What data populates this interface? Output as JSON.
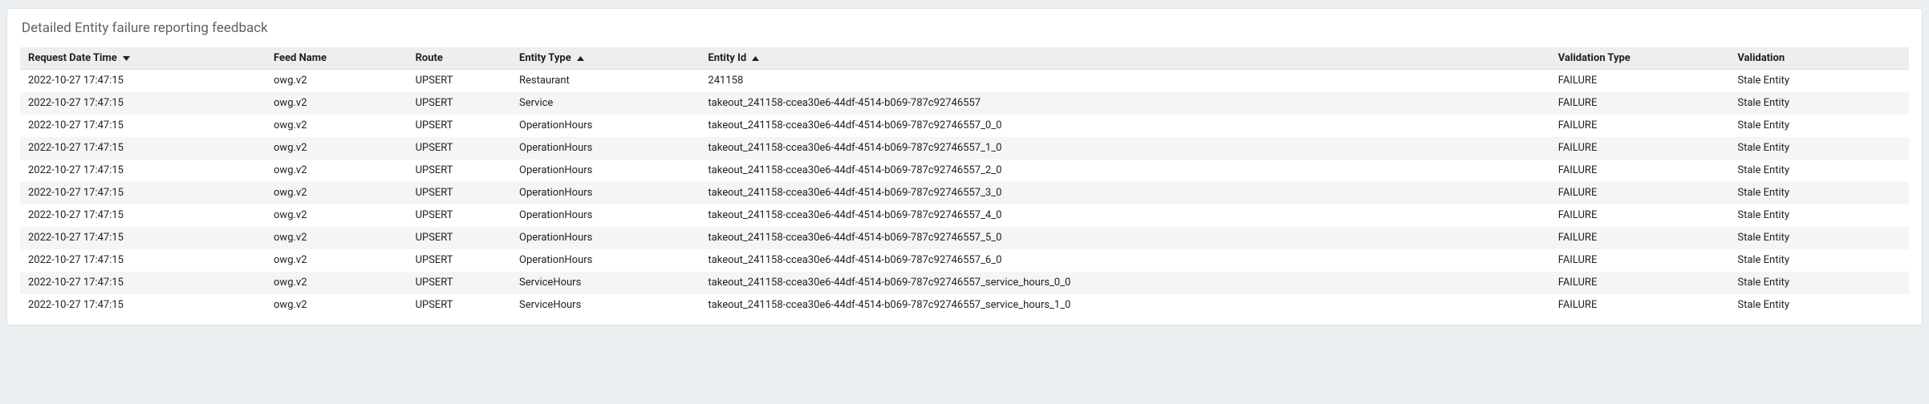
{
  "title": "Detailed Entity failure reporting feedback",
  "columns": {
    "request_datetime": "Request Date Time",
    "feed_name": "Feed Name",
    "route": "Route",
    "entity_type": "Entity Type",
    "entity_id": "Entity Id",
    "validation_type": "Validation Type",
    "validation": "Validation"
  },
  "sort": {
    "request_datetime": "desc",
    "entity_type": "asc",
    "entity_id": "asc"
  },
  "failure_color": "#c5221f",
  "rows": [
    {
      "request_datetime": "2022-10-27 17:47:15",
      "feed_name": "owg.v2",
      "route": "UPSERT",
      "entity_type": "Restaurant",
      "entity_id": "241158",
      "validation_type": "FAILURE",
      "validation": "Stale Entity"
    },
    {
      "request_datetime": "2022-10-27 17:47:15",
      "feed_name": "owg.v2",
      "route": "UPSERT",
      "entity_type": "Service",
      "entity_id": "takeout_241158-ccea30e6-44df-4514-b069-787c92746557",
      "validation_type": "FAILURE",
      "validation": "Stale Entity"
    },
    {
      "request_datetime": "2022-10-27 17:47:15",
      "feed_name": "owg.v2",
      "route": "UPSERT",
      "entity_type": "OperationHours",
      "entity_id": "takeout_241158-ccea30e6-44df-4514-b069-787c92746557_0_0",
      "validation_type": "FAILURE",
      "validation": "Stale Entity"
    },
    {
      "request_datetime": "2022-10-27 17:47:15",
      "feed_name": "owg.v2",
      "route": "UPSERT",
      "entity_type": "OperationHours",
      "entity_id": "takeout_241158-ccea30e6-44df-4514-b069-787c92746557_1_0",
      "validation_type": "FAILURE",
      "validation": "Stale Entity"
    },
    {
      "request_datetime": "2022-10-27 17:47:15",
      "feed_name": "owg.v2",
      "route": "UPSERT",
      "entity_type": "OperationHours",
      "entity_id": "takeout_241158-ccea30e6-44df-4514-b069-787c92746557_2_0",
      "validation_type": "FAILURE",
      "validation": "Stale Entity"
    },
    {
      "request_datetime": "2022-10-27 17:47:15",
      "feed_name": "owg.v2",
      "route": "UPSERT",
      "entity_type": "OperationHours",
      "entity_id": "takeout_241158-ccea30e6-44df-4514-b069-787c92746557_3_0",
      "validation_type": "FAILURE",
      "validation": "Stale Entity"
    },
    {
      "request_datetime": "2022-10-27 17:47:15",
      "feed_name": "owg.v2",
      "route": "UPSERT",
      "entity_type": "OperationHours",
      "entity_id": "takeout_241158-ccea30e6-44df-4514-b069-787c92746557_4_0",
      "validation_type": "FAILURE",
      "validation": "Stale Entity"
    },
    {
      "request_datetime": "2022-10-27 17:47:15",
      "feed_name": "owg.v2",
      "route": "UPSERT",
      "entity_type": "OperationHours",
      "entity_id": "takeout_241158-ccea30e6-44df-4514-b069-787c92746557_5_0",
      "validation_type": "FAILURE",
      "validation": "Stale Entity"
    },
    {
      "request_datetime": "2022-10-27 17:47:15",
      "feed_name": "owg.v2",
      "route": "UPSERT",
      "entity_type": "OperationHours",
      "entity_id": "takeout_241158-ccea30e6-44df-4514-b069-787c92746557_6_0",
      "validation_type": "FAILURE",
      "validation": "Stale Entity"
    },
    {
      "request_datetime": "2022-10-27 17:47:15",
      "feed_name": "owg.v2",
      "route": "UPSERT",
      "entity_type": "ServiceHours",
      "entity_id": "takeout_241158-ccea30e6-44df-4514-b069-787c92746557_service_hours_0_0",
      "validation_type": "FAILURE",
      "validation": "Stale Entity"
    },
    {
      "request_datetime": "2022-10-27 17:47:15",
      "feed_name": "owg.v2",
      "route": "UPSERT",
      "entity_type": "ServiceHours",
      "entity_id": "takeout_241158-ccea30e6-44df-4514-b069-787c92746557_service_hours_1_0",
      "validation_type": "FAILURE",
      "validation": "Stale Entity"
    }
  ]
}
